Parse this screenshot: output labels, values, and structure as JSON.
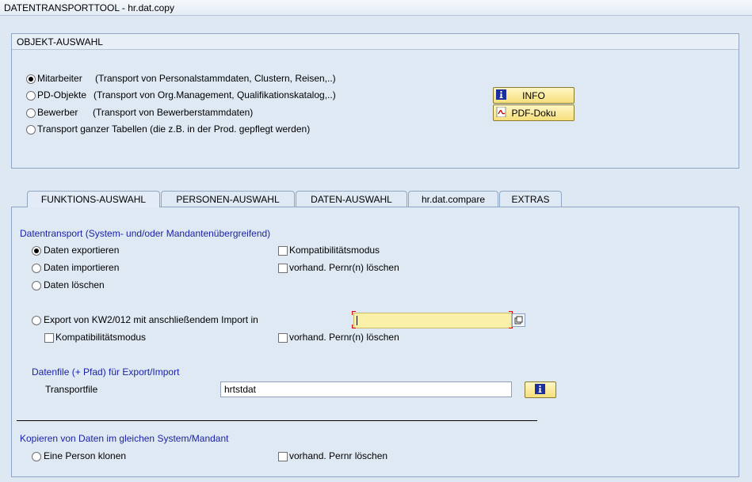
{
  "window": {
    "title": "DATENTRANSPORTTOOL - hr.dat.copy"
  },
  "objekt": {
    "title": "OBJEKT-AUSWAHL",
    "options": [
      {
        "label": "Mitarbeiter",
        "desc": "(Transport von Personalstammdaten, Clustern, Reisen,..)",
        "selected": true
      },
      {
        "label": "PD-Objekte",
        "desc": "(Transport von Org.Management, Qualifikationskatalog,..)",
        "selected": false
      },
      {
        "label": "Bewerber",
        "desc": "(Transport von Bewerberstammdaten)",
        "selected": false
      },
      {
        "label": "Transport ganzer Tabellen (die z.B. in der Prod. gepflegt werden)",
        "desc": "",
        "selected": false
      }
    ],
    "info_button": "INFO",
    "pdf_button": "PDF-Doku"
  },
  "tabs": [
    {
      "label": "FUNKTIONS-AUSWAHL",
      "active": true
    },
    {
      "label": "PERSONEN-AUSWAHL",
      "active": false
    },
    {
      "label": "DATEN-AUSWAHL",
      "active": false
    },
    {
      "label": "hr.dat.compare",
      "active": false
    },
    {
      "label": "EXTRAS",
      "active": false
    }
  ],
  "funktion": {
    "section_title": "Datentransport (System- und/oder Mandantenübergreifend)",
    "radio_export": "Daten exportieren",
    "radio_import": "Daten importieren",
    "radio_delete": "Daten löschen",
    "check_kompat": "Kompatibilitätsmodus",
    "check_pernr": "vorhand. Pernr(n) löschen",
    "radio_kw": "Export von KW2/012 mit anschließendem Import in",
    "kw_value": "",
    "check_kompat2": "Kompatibilitätsmodus",
    "check_pernr2": "vorhand. Pernr(n) löschen",
    "file_title": "Datenfile (+ Pfad) für Export/Import",
    "file_label": "Transportfile",
    "file_value": "hrtstdat",
    "copy_title": "Kopieren von Daten im gleichen System/Mandant",
    "radio_clone": "Eine Person klonen",
    "check_pernr3": "vorhand. Pernr löschen"
  },
  "colors": {
    "accent_blue": "#1a23a8",
    "button_yellow": "#f6df7c"
  }
}
